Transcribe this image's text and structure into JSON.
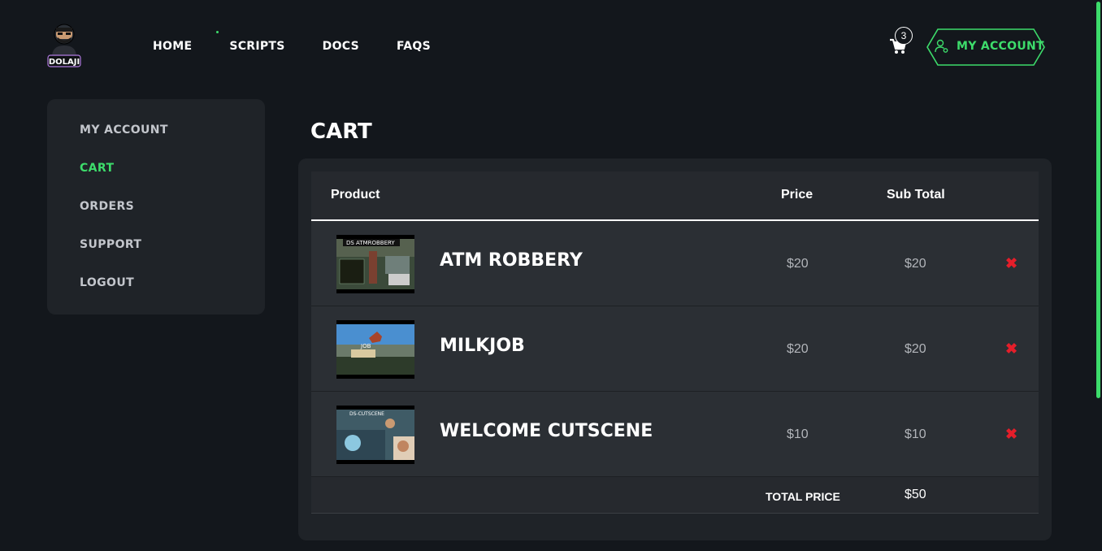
{
  "header": {
    "nav": [
      {
        "label": "HOME"
      },
      {
        "label": "SCRIPTS"
      },
      {
        "label": "DOCS"
      },
      {
        "label": "FAQS"
      }
    ],
    "cart_count": "3",
    "account_label": "MY ACCOUNT",
    "logo_text": "DOLAJI"
  },
  "sidebar": {
    "items": [
      {
        "label": "MY ACCOUNT"
      },
      {
        "label": "CART"
      },
      {
        "label": "ORDERS"
      },
      {
        "label": "SUPPORT"
      },
      {
        "label": "LOGOUT"
      }
    ]
  },
  "cart": {
    "title": "CART",
    "columns": {
      "product": "Product",
      "price": "Price",
      "subtotal": "Sub Total"
    },
    "items": [
      {
        "name": "ATM ROBBERY",
        "price": "$20",
        "subtotal": "$20",
        "thumb_caption": "DS ATMROBBERY"
      },
      {
        "name": "MILKJOB",
        "price": "$20",
        "subtotal": "$20",
        "thumb_caption": "JOB"
      },
      {
        "name": "WELCOME CUTSCENE",
        "price": "$10",
        "subtotal": "$10",
        "thumb_caption": "DS-CUTSCENE"
      }
    ],
    "total_label": "TOTAL PRICE",
    "total_value": "$50",
    "remove_glyph": "✖"
  },
  "colors": {
    "accent": "#3ddc6b",
    "remove": "#e51e2a",
    "background": "#13171c",
    "panel": "#1f2328"
  }
}
